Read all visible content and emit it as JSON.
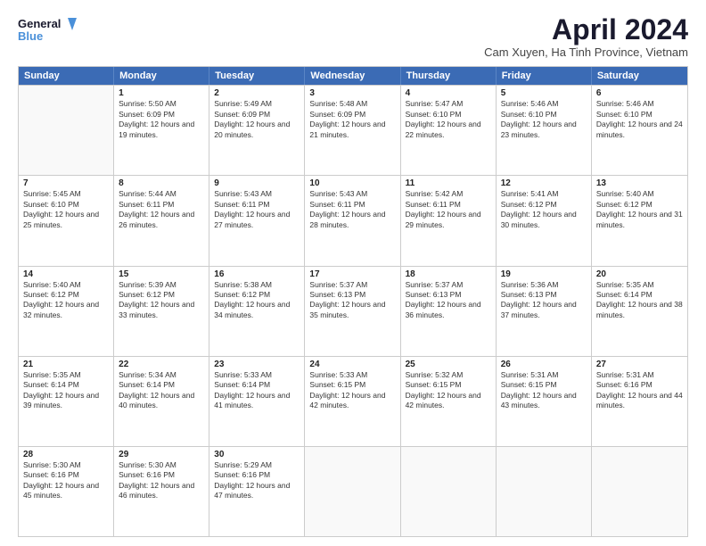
{
  "header": {
    "logo_line1": "General",
    "logo_line2": "Blue",
    "main_title": "April 2024",
    "subtitle": "Cam Xuyen, Ha Tinh Province, Vietnam"
  },
  "weekdays": [
    "Sunday",
    "Monday",
    "Tuesday",
    "Wednesday",
    "Thursday",
    "Friday",
    "Saturday"
  ],
  "rows": [
    [
      {
        "day": "",
        "empty": true
      },
      {
        "day": "1",
        "sunrise": "5:50 AM",
        "sunset": "6:09 PM",
        "daylight": "12 hours and 19 minutes."
      },
      {
        "day": "2",
        "sunrise": "5:49 AM",
        "sunset": "6:09 PM",
        "daylight": "12 hours and 20 minutes."
      },
      {
        "day": "3",
        "sunrise": "5:48 AM",
        "sunset": "6:09 PM",
        "daylight": "12 hours and 21 minutes."
      },
      {
        "day": "4",
        "sunrise": "5:47 AM",
        "sunset": "6:10 PM",
        "daylight": "12 hours and 22 minutes."
      },
      {
        "day": "5",
        "sunrise": "5:46 AM",
        "sunset": "6:10 PM",
        "daylight": "12 hours and 23 minutes."
      },
      {
        "day": "6",
        "sunrise": "5:46 AM",
        "sunset": "6:10 PM",
        "daylight": "12 hours and 24 minutes."
      }
    ],
    [
      {
        "day": "7",
        "sunrise": "5:45 AM",
        "sunset": "6:10 PM",
        "daylight": "12 hours and 25 minutes."
      },
      {
        "day": "8",
        "sunrise": "5:44 AM",
        "sunset": "6:11 PM",
        "daylight": "12 hours and 26 minutes."
      },
      {
        "day": "9",
        "sunrise": "5:43 AM",
        "sunset": "6:11 PM",
        "daylight": "12 hours and 27 minutes."
      },
      {
        "day": "10",
        "sunrise": "5:43 AM",
        "sunset": "6:11 PM",
        "daylight": "12 hours and 28 minutes."
      },
      {
        "day": "11",
        "sunrise": "5:42 AM",
        "sunset": "6:11 PM",
        "daylight": "12 hours and 29 minutes."
      },
      {
        "day": "12",
        "sunrise": "5:41 AM",
        "sunset": "6:12 PM",
        "daylight": "12 hours and 30 minutes."
      },
      {
        "day": "13",
        "sunrise": "5:40 AM",
        "sunset": "6:12 PM",
        "daylight": "12 hours and 31 minutes."
      }
    ],
    [
      {
        "day": "14",
        "sunrise": "5:40 AM",
        "sunset": "6:12 PM",
        "daylight": "12 hours and 32 minutes."
      },
      {
        "day": "15",
        "sunrise": "5:39 AM",
        "sunset": "6:12 PM",
        "daylight": "12 hours and 33 minutes."
      },
      {
        "day": "16",
        "sunrise": "5:38 AM",
        "sunset": "6:12 PM",
        "daylight": "12 hours and 34 minutes."
      },
      {
        "day": "17",
        "sunrise": "5:37 AM",
        "sunset": "6:13 PM",
        "daylight": "12 hours and 35 minutes."
      },
      {
        "day": "18",
        "sunrise": "5:37 AM",
        "sunset": "6:13 PM",
        "daylight": "12 hours and 36 minutes."
      },
      {
        "day": "19",
        "sunrise": "5:36 AM",
        "sunset": "6:13 PM",
        "daylight": "12 hours and 37 minutes."
      },
      {
        "day": "20",
        "sunrise": "5:35 AM",
        "sunset": "6:14 PM",
        "daylight": "12 hours and 38 minutes."
      }
    ],
    [
      {
        "day": "21",
        "sunrise": "5:35 AM",
        "sunset": "6:14 PM",
        "daylight": "12 hours and 39 minutes."
      },
      {
        "day": "22",
        "sunrise": "5:34 AM",
        "sunset": "6:14 PM",
        "daylight": "12 hours and 40 minutes."
      },
      {
        "day": "23",
        "sunrise": "5:33 AM",
        "sunset": "6:14 PM",
        "daylight": "12 hours and 41 minutes."
      },
      {
        "day": "24",
        "sunrise": "5:33 AM",
        "sunset": "6:15 PM",
        "daylight": "12 hours and 42 minutes."
      },
      {
        "day": "25",
        "sunrise": "5:32 AM",
        "sunset": "6:15 PM",
        "daylight": "12 hours and 42 minutes."
      },
      {
        "day": "26",
        "sunrise": "5:31 AM",
        "sunset": "6:15 PM",
        "daylight": "12 hours and 43 minutes."
      },
      {
        "day": "27",
        "sunrise": "5:31 AM",
        "sunset": "6:16 PM",
        "daylight": "12 hours and 44 minutes."
      }
    ],
    [
      {
        "day": "28",
        "sunrise": "5:30 AM",
        "sunset": "6:16 PM",
        "daylight": "12 hours and 45 minutes."
      },
      {
        "day": "29",
        "sunrise": "5:30 AM",
        "sunset": "6:16 PM",
        "daylight": "12 hours and 46 minutes."
      },
      {
        "day": "30",
        "sunrise": "5:29 AM",
        "sunset": "6:16 PM",
        "daylight": "12 hours and 47 minutes."
      },
      {
        "day": "",
        "empty": true
      },
      {
        "day": "",
        "empty": true
      },
      {
        "day": "",
        "empty": true
      },
      {
        "day": "",
        "empty": true
      }
    ]
  ],
  "labels": {
    "sunrise_prefix": "Sunrise: ",
    "sunset_prefix": "Sunset: ",
    "daylight_prefix": "Daylight: "
  }
}
